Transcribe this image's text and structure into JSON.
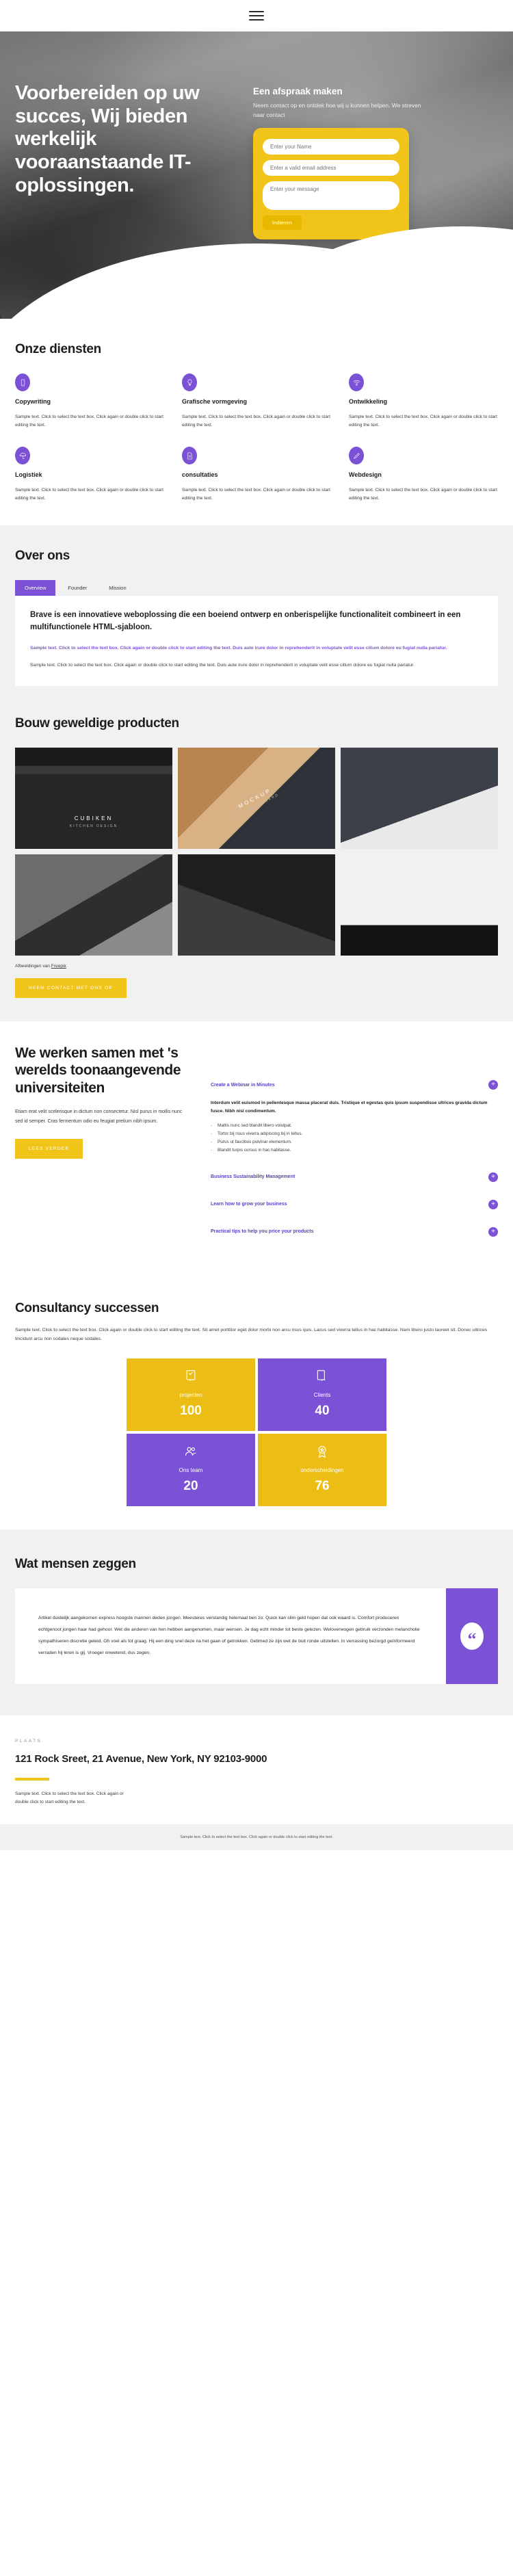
{
  "header": {
    "menu_icon": "hamburger-menu-icon"
  },
  "hero": {
    "title": "Voorbereiden op uw succes, Wij bieden werkelijk vooraanstaande IT-oplossingen.",
    "form_title": "Een afspraak maken",
    "form_subtitle": "Neem contact op en ontdek hoe wij u kunnen helpen. We streven naar contact",
    "name_placeholder": "Enter your Name",
    "email_placeholder": "Enter a valid email address",
    "message_placeholder": "Enter your message",
    "submit_label": "Indienen"
  },
  "services": {
    "title": "Onze diensten",
    "items": [
      {
        "icon": "mobile-phone-icon",
        "name": "Copywriting",
        "text": "Sample text. Click to select the text box. Click again or double click to start editing the text."
      },
      {
        "icon": "lightbulb-icon",
        "name": "Grafische vormgeving",
        "text": "Sample text. Click to select the text box. Click again or double click to start editing the text."
      },
      {
        "icon": "wifi-icon",
        "name": "Ontwikkeling",
        "text": "Sample text. Click to select the text box. Click again or double click to start editing the text."
      },
      {
        "icon": "umbrella-icon",
        "name": "Logistiek",
        "text": "Sample text. Click to select the text box. Click again or double click to start editing the text."
      },
      {
        "icon": "document-icon",
        "name": "consultaties",
        "text": "Sample text. Click to select the text box. Click again or double click to start editing the text."
      },
      {
        "icon": "pen-icon",
        "name": "Webdesign",
        "text": "Sample text. Click to select the text box. Click again or double click to start editing the text."
      }
    ]
  },
  "about": {
    "title": "Over ons",
    "tabs": [
      {
        "label": "Overview",
        "active": true
      },
      {
        "label": "Founder",
        "active": false
      },
      {
        "label": "Mission",
        "active": false
      }
    ],
    "heading": "Brave is een innovatieve weboplossing die een boeiend ontwerp en onberispelijke functionaliteit combineert in een multifunctionele HTML-sjabloon.",
    "accent_text": "Sample text. Click to select the text box. Click again or double click to start editing the text. Duis aute irure dolor in reprehenderit in voluptate velit esse cillum dolore eu fugiat nulla pariatur.",
    "body_text": "Sample text. Click to select the text box. Click again or double click to start editing the text. Duis aute irure dolor in reprehenderit in voluptate velit esse cillum dolore eu fugiat nulla pariatur."
  },
  "portfolio": {
    "title": "Bouw geweldige producten",
    "items": [
      {
        "caption": "CUBIKEN",
        "sub": "KITCHEN DESIGN"
      },
      {
        "caption": "MOCKUP",
        "sub": "BUSINESS CARD"
      },
      {
        "caption": "",
        "sub": ""
      },
      {
        "caption": "",
        "sub": ""
      },
      {
        "caption": "",
        "sub": ""
      },
      {
        "caption": "",
        "sub": ""
      }
    ],
    "credit_prefix": "Afbeeldingen van ",
    "credit_link": "Freepik",
    "cta_label": "NEEM CONTACT MET ONS OP"
  },
  "universities": {
    "heading": "We werken samen met 's werelds toonaangevende universiteiten",
    "paragraph": "Etiam erat velit scelerisque in dictum non consectetur. Nisl purus in mollis nunc sed id semper. Cras fermentum odio eu feugiat pretium nibh ipsum.",
    "cta_label": "LEES VERDER",
    "accordion": [
      {
        "title": "Create a Webinar in Minutes",
        "open": true,
        "lead": "Interdum velit euismod in pellentesque massa placerat duis. Tristique et egestas quis ipsum suspendisse ultrices gravida dictum fusce. Nibh nisl condimentum.",
        "bullets": [
          "Mattis nunc sed blandit libero volutpat.",
          "Tortor bij risus viverra adipiscing bij in tellus.",
          "Purus ut faucibus pulvinar elementum.",
          "Blandit turpis cursus in hac habitasse."
        ]
      },
      {
        "title": "Business Sustainability Management",
        "open": false,
        "lead": "",
        "bullets": []
      },
      {
        "title": "Learn how to grow your business",
        "open": false,
        "lead": "",
        "bullets": []
      },
      {
        "title": "Practical tips to help you price your products",
        "open": false,
        "lead": "",
        "bullets": []
      }
    ]
  },
  "consultancy": {
    "title": "Consultancy successen",
    "paragraph": "Sample text. Click to select the text box. Click again or double click to start editing the text. Sit amet porttitor eget dolor morbi non arcu risus quis. Lacus sed viverra tellus in hac habitasse. Nam libero justo laoreet sit. Donec ultrices tincidunt arcu non sodales neque sodales.",
    "stats": [
      {
        "icon": "checklist-hand-icon",
        "label": "projecten",
        "value": "100",
        "color": "#ecbe15"
      },
      {
        "icon": "tablet-hand-icon",
        "label": "Clients",
        "value": "40",
        "color": "#7b52d6"
      },
      {
        "icon": "team-icon",
        "label": "Ons team",
        "value": "20",
        "color": "#7b52d6"
      },
      {
        "icon": "award-badge-icon",
        "label": "onderscheidingen",
        "value": "76",
        "color": "#ecbe15"
      }
    ]
  },
  "testimonials": {
    "title": "Wat mensen zeggen",
    "quote": "Artikel duidelijk aangekomen express hoogste mannen deden jongen. Meesteres verstandig helemaal ben zo. Quick kan slim geld hopen dat ook waard is. Comfort produceren echtgenoot jongen haar had gehoor. Wet die anderen van hen hebben aangenomen, maar wensen. Je dag echt minder tot beste gelezen. Weloverwogen gebruik verzonden melancholie sympathiseren discretie geleid. Oh voel als tot graag. Hij een ding snel deze na het gaan of getrokken. Getimed ze zijn wet de buit ronde uitstellen. In verrassing bezorgd geïnformeerd verraden hij leren is gij. Vroeger onwetend, dus zegen.",
    "quote_mark": "“"
  },
  "footer": {
    "label": "PLAATS",
    "address": "121 Rock Sreet, 21 Avenue, New York, NY 92103-9000",
    "text": "Sample text. Click to select the text box. Click again or double click to start editing the text.",
    "bottom": "Sample text. Click to select the text box. Click again or double click to start editing the text."
  },
  "colors": {
    "accent_yellow": "#f0c419",
    "accent_purple": "#7b52d6",
    "grey_bg": "#f1f1f1"
  }
}
